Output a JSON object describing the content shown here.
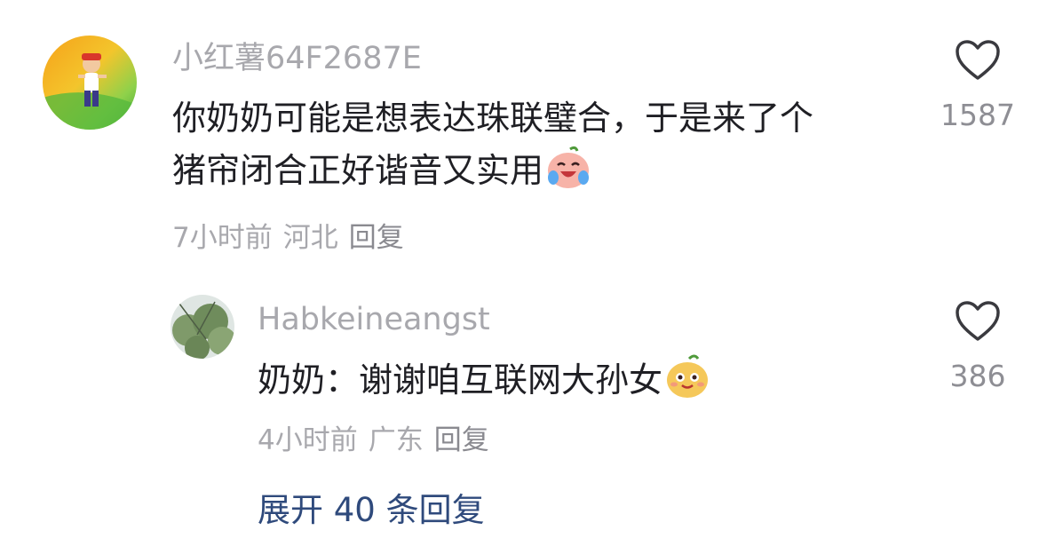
{
  "comments": [
    {
      "username": "小红薯64F2687E",
      "text_line1": "你奶奶可能是想表达珠联璧合，于是来了个",
      "text_line2": "猪帘闭合正好谐音又实用",
      "emoji": "laugh-cry-emoji",
      "time": "7小时前",
      "location": "河北",
      "reply_label": "回复",
      "like_count": "1587"
    },
    {
      "username": "Habkeineangst",
      "text_line1": "奶奶：谢谢咱互联网大孙女",
      "emoji": "proud-face-emoji",
      "time": "4小时前",
      "location": "广东",
      "reply_label": "回复",
      "like_count": "386"
    }
  ],
  "expand_replies": "展开 40 条回复",
  "icons": {
    "like": "heart-outline-icon"
  },
  "colors": {
    "username": "#a8a8ad",
    "text": "#1f1f24",
    "link": "#2f4a7c"
  }
}
